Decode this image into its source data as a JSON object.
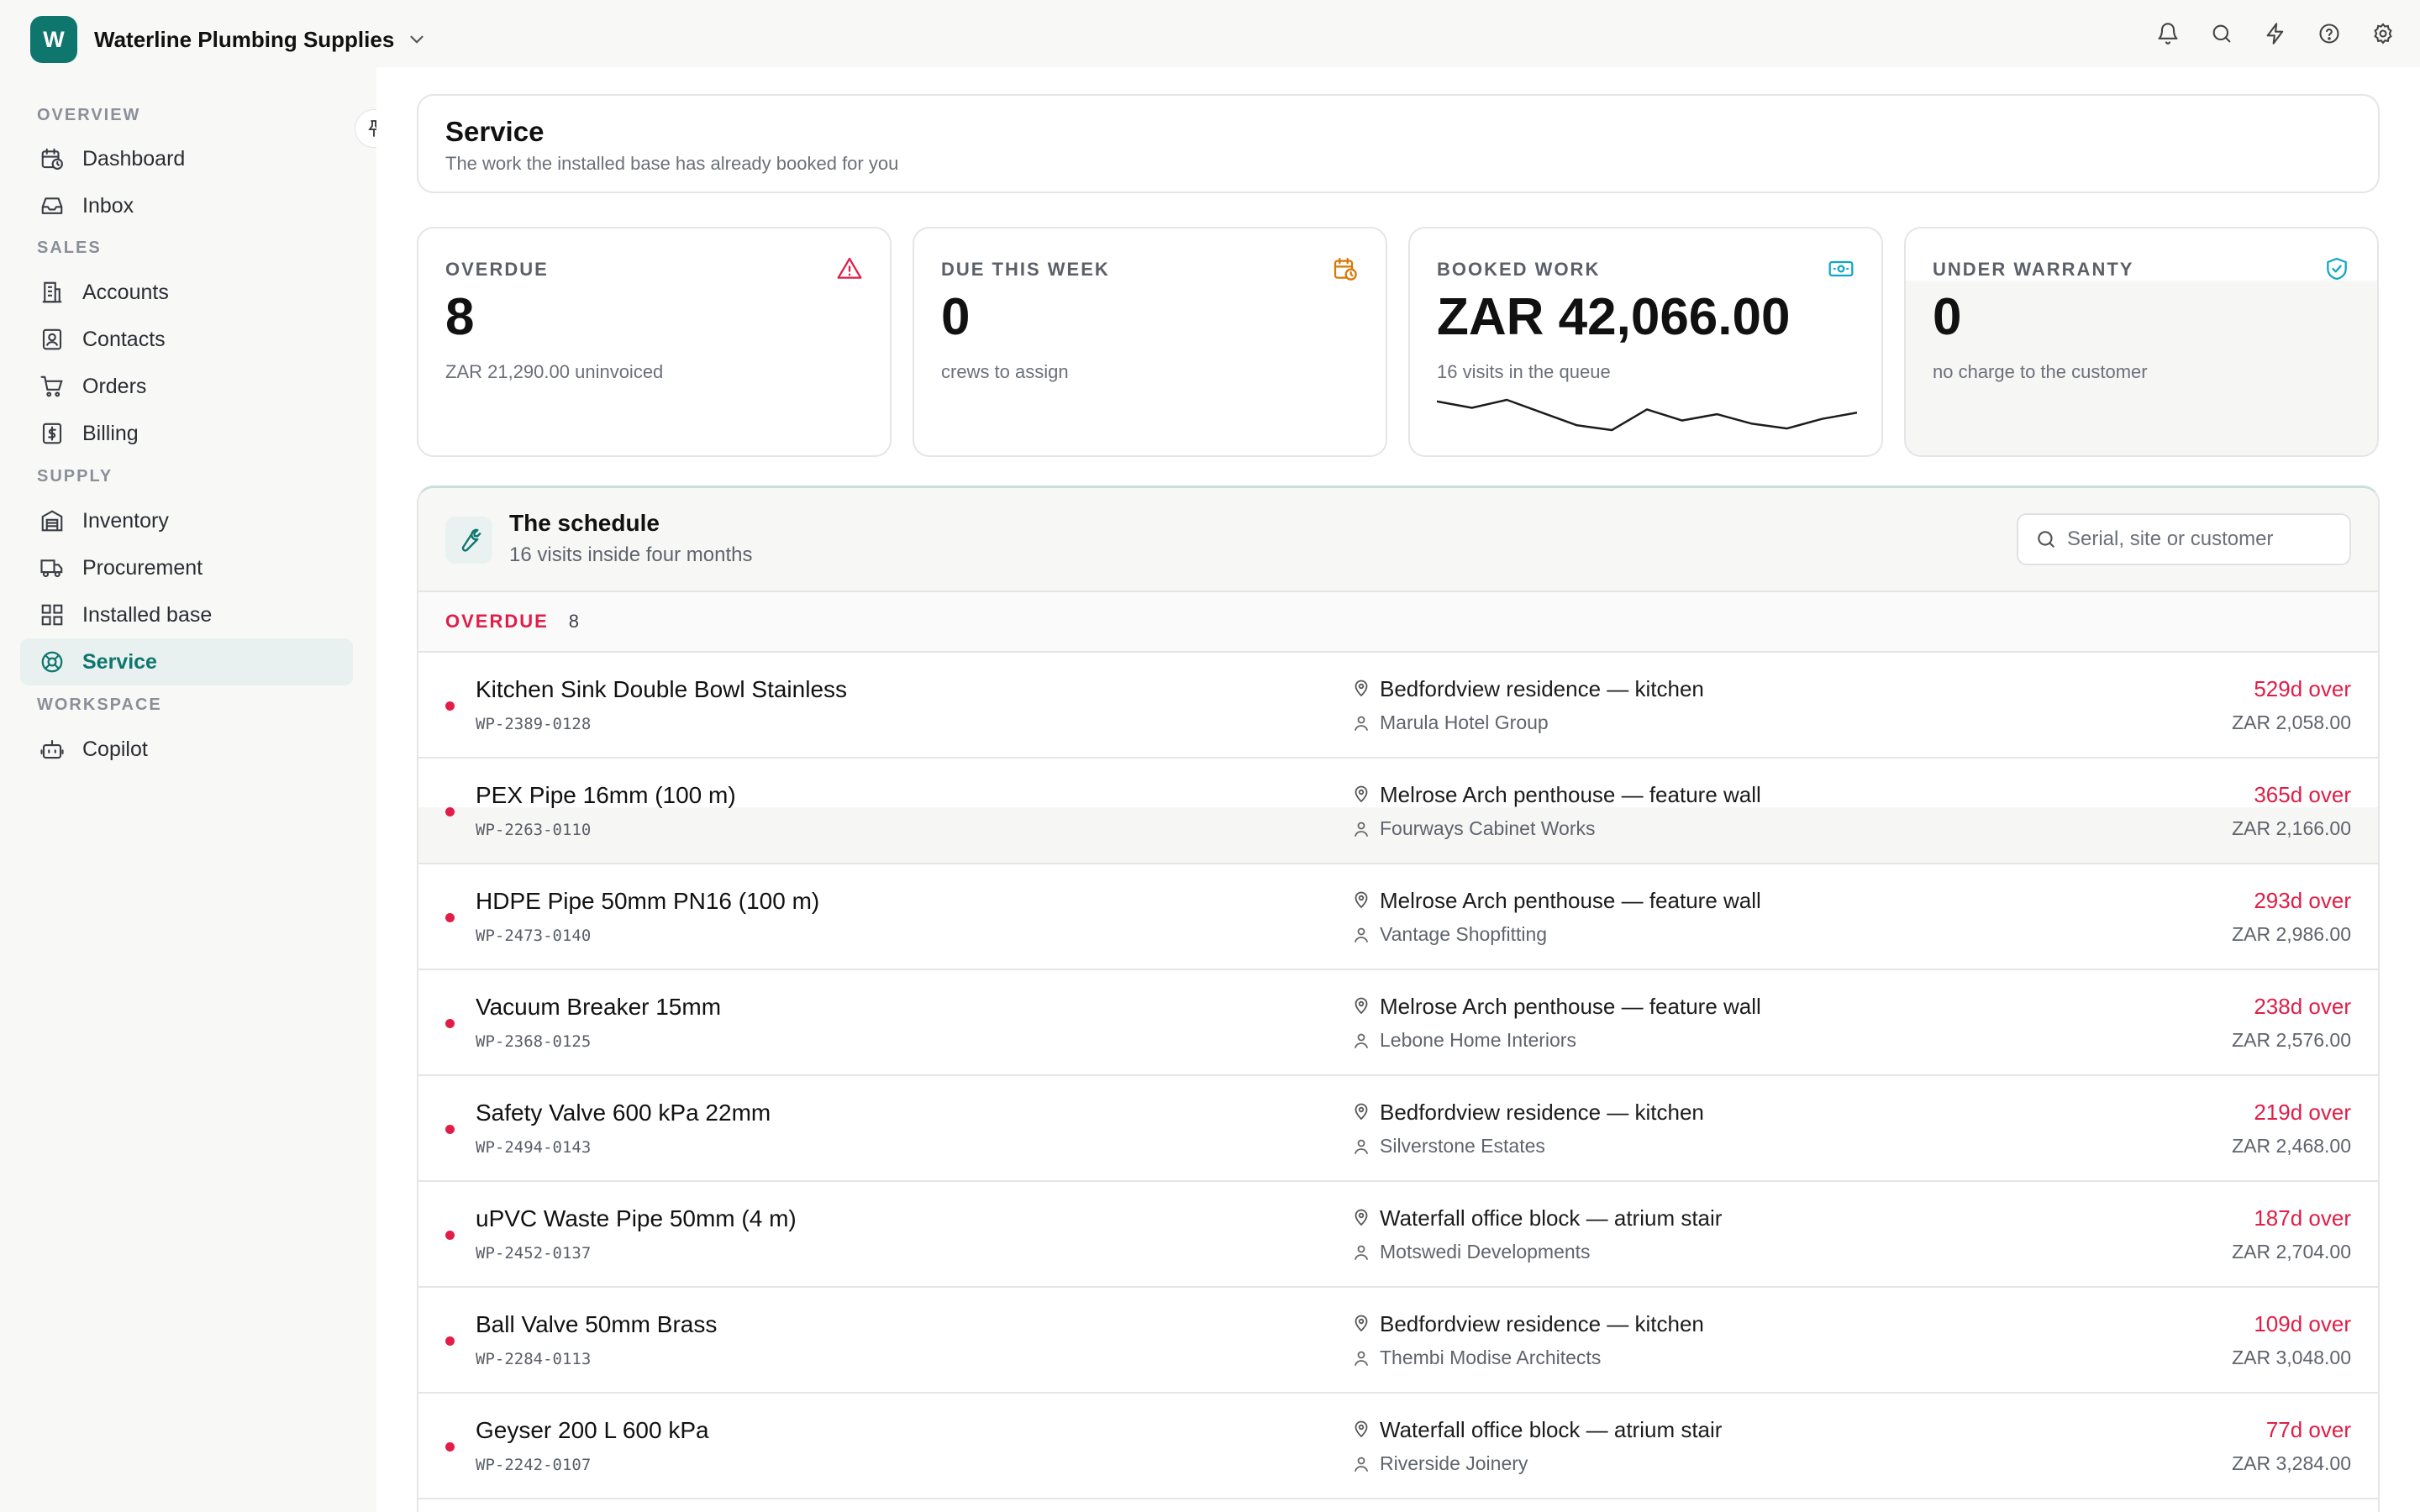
{
  "org": {
    "logo_letter": "W",
    "name": "Waterline Plumbing Supplies"
  },
  "top_icons": [
    "bell-icon",
    "search-icon",
    "bolt-icon",
    "help-icon",
    "gear-icon"
  ],
  "sidebar": {
    "sections": [
      {
        "label": "OVERVIEW",
        "items": [
          {
            "label": "Dashboard",
            "icon": "calendar-clock-icon"
          },
          {
            "label": "Inbox",
            "icon": "inbox-icon"
          }
        ]
      },
      {
        "label": "SALES",
        "items": [
          {
            "label": "Accounts",
            "icon": "building-icon"
          },
          {
            "label": "Contacts",
            "icon": "contact-icon"
          },
          {
            "label": "Orders",
            "icon": "cart-icon"
          },
          {
            "label": "Billing",
            "icon": "dollar-icon"
          }
        ]
      },
      {
        "label": "SUPPLY",
        "items": [
          {
            "label": "Inventory",
            "icon": "warehouse-icon"
          },
          {
            "label": "Procurement",
            "icon": "truck-icon"
          },
          {
            "label": "Installed base",
            "icon": "grid-icon"
          },
          {
            "label": "Service",
            "icon": "lifebuoy-icon",
            "active": true
          }
        ]
      },
      {
        "label": "WORKSPACE",
        "items": [
          {
            "label": "Copilot",
            "icon": "bot-icon"
          }
        ]
      }
    ]
  },
  "header": {
    "title": "Service",
    "subtitle": "The work the installed base has already booked for you"
  },
  "stats": [
    {
      "label": "OVERDUE",
      "value": "8",
      "sub": "ZAR 21,290.00 uninvoiced",
      "icon": "warning-icon",
      "color": "#e11d48"
    },
    {
      "label": "DUE THIS WEEK",
      "value": "0",
      "sub": "crews to assign",
      "icon": "calendar-clock-icon",
      "color": "#d97706"
    },
    {
      "label": "BOOKED WORK",
      "value": "ZAR 42,066.00",
      "sub": "16 visits in the queue",
      "icon": "banknote-icon",
      "color": "#0ea5c6"
    },
    {
      "label": "UNDER WARRANTY",
      "value": "0",
      "sub": "no charge to the customer",
      "icon": "shield-check-icon",
      "color": "#0ea5c6"
    }
  ],
  "sparkline": [
    2.8,
    2.4,
    2.9,
    2.1,
    1.3,
    1.0,
    2.3,
    1.6,
    2.0,
    1.4,
    1.1,
    1.7,
    2.1
  ],
  "schedule": {
    "title": "The schedule",
    "subtitle": "16 visits inside four months",
    "search_placeholder": "Serial, site or customer",
    "group": {
      "label": "OVERDUE",
      "count": "8"
    },
    "rows": [
      {
        "name": "Kitchen Sink Double Bowl Stainless",
        "serial": "WP-2389-0128",
        "site": "Bedfordview residence — kitchen",
        "customer": "Marula Hotel Group",
        "overdue": "529d over",
        "amount": "ZAR 2,058.00"
      },
      {
        "name": "PEX Pipe 16mm (100 m)",
        "serial": "WP-2263-0110",
        "site": "Melrose Arch penthouse — feature wall",
        "customer": "Fourways Cabinet Works",
        "overdue": "365d over",
        "amount": "ZAR 2,166.00"
      },
      {
        "name": "HDPE Pipe 50mm PN16 (100 m)",
        "serial": "WP-2473-0140",
        "site": "Melrose Arch penthouse — feature wall",
        "customer": "Vantage Shopfitting",
        "overdue": "293d over",
        "amount": "ZAR 2,986.00"
      },
      {
        "name": "Vacuum Breaker 15mm",
        "serial": "WP-2368-0125",
        "site": "Melrose Arch penthouse — feature wall",
        "customer": "Lebone Home Interiors",
        "overdue": "238d over",
        "amount": "ZAR 2,576.00"
      },
      {
        "name": "Safety Valve 600 kPa 22mm",
        "serial": "WP-2494-0143",
        "site": "Bedfordview residence — kitchen",
        "customer": "Silverstone Estates",
        "overdue": "219d over",
        "amount": "ZAR 2,468.00"
      },
      {
        "name": "uPVC Waste Pipe 50mm (4 m)",
        "serial": "WP-2452-0137",
        "site": "Waterfall office block — atrium stair",
        "customer": "Motswedi Developments",
        "overdue": "187d over",
        "amount": "ZAR 2,704.00"
      },
      {
        "name": "Ball Valve 50mm Brass",
        "serial": "WP-2284-0113",
        "site": "Bedfordview residence — kitchen",
        "customer": "Thembi Modise Architects",
        "overdue": "109d over",
        "amount": "ZAR 3,048.00"
      },
      {
        "name": "Geyser 200 L 600 kPa",
        "serial": "WP-2242-0107",
        "site": "Waterfall office block — atrium stair",
        "customer": "Riverside Joinery",
        "overdue": "77d over",
        "amount": "ZAR 3,284.00"
      }
    ]
  }
}
